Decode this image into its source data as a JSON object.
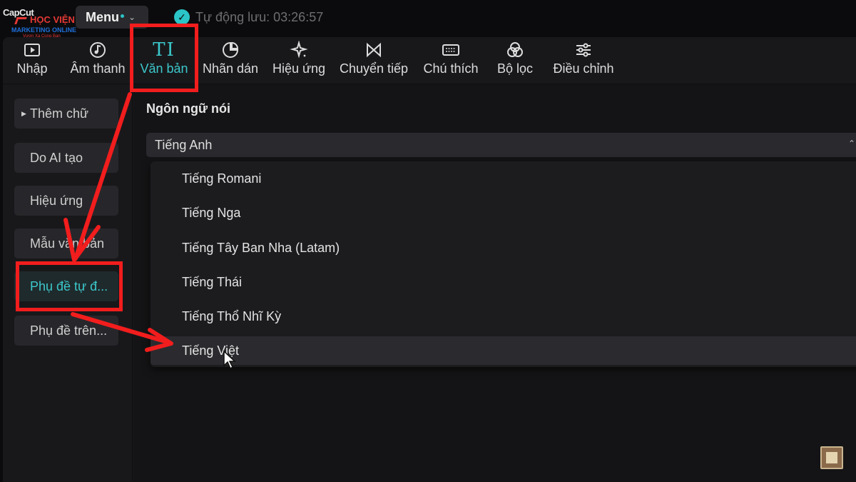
{
  "logo": {
    "brand": "CapCut",
    "org_line1": "HỌC VIỆN",
    "org_line2": "MARKETING ONLINE",
    "org_line3": "Vươn Xa Cùng Bạn"
  },
  "titlebar": {
    "menu_label": "Menu",
    "autosave_text": "Tự động lưu: 03:26:57"
  },
  "toolbar": {
    "items": [
      {
        "label": "Nhập",
        "icon": "video-icon"
      },
      {
        "label": "Âm thanh",
        "icon": "music-icon"
      },
      {
        "label": "Văn bản",
        "icon": "text-icon",
        "active": true
      },
      {
        "label": "Nhãn dán",
        "icon": "sticker-icon"
      },
      {
        "label": "Hiệu ứng",
        "icon": "sparkle-icon"
      },
      {
        "label": "Chuyển tiếp",
        "icon": "transition-icon"
      },
      {
        "label": "Chú thích",
        "icon": "caption-icon"
      },
      {
        "label": "Bộ lọc",
        "icon": "filter-icon"
      },
      {
        "label": "Điều chỉnh",
        "icon": "adjust-icon"
      }
    ]
  },
  "sidebar": {
    "items": [
      {
        "label": "Thêm chữ"
      },
      {
        "label": "Do AI tạo"
      },
      {
        "label": "Hiệu ứng"
      },
      {
        "label": "Mẫu văn bản"
      },
      {
        "label": "Phụ đề tự đ...",
        "active": true
      },
      {
        "label": "Phụ đề trên..."
      }
    ]
  },
  "content": {
    "section_title": "Ngôn ngữ nói",
    "selected_language": "Tiếng Anh",
    "options": [
      "Tiếng Romani",
      "Tiếng Nga",
      "Tiếng Tây Ban Nha (Latam)",
      "Tiếng Thái",
      "Tiếng Thổ Nhĩ Kỳ",
      "Tiếng Việt"
    ],
    "hovered_option": "Tiếng Việt"
  },
  "colors": {
    "accent": "#3cc8cb",
    "annotation": "#f21d1d",
    "background": "#0b0b0d",
    "panel": "#18181b"
  }
}
